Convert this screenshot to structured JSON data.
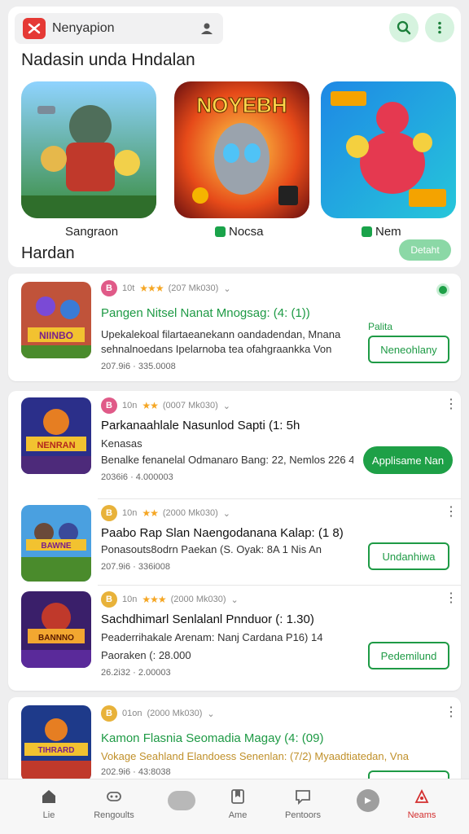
{
  "header": {
    "search_text": "Nenyapion",
    "icons": [
      "app-logo-icon",
      "profile-icon",
      "search-icon",
      "more-vertical-icon"
    ]
  },
  "featured": {
    "title": "Nadasin unda Hndalan",
    "items": [
      {
        "label": "Sangraon",
        "lock": false,
        "art_text": ""
      },
      {
        "label": "Nocsa",
        "lock": true,
        "art_text": "NOYEBH"
      },
      {
        "label": "Nem",
        "lock": true,
        "art_text": ""
      }
    ]
  },
  "section": {
    "title": "Hardan",
    "pill_label": "Detaht"
  },
  "list_items": [
    {
      "badge": "B",
      "badge_color": "#e05a88",
      "meta_prefix": "10t",
      "stars": "★★★",
      "meta_info": "(207 Mk030)",
      "title": "Pangen Nitsel Nanat Mnogsag: (4: (1))",
      "title_green": true,
      "desc1": "Upekalekoal filartaeanekann oandadendan, Mnana",
      "desc2": "sehnalnoedans Ipelarnoba tea ofahgraankka Von",
      "sub": "207.9i6 · 335.0008",
      "side_text": "Palita",
      "button_label": "Neneohlany",
      "button_style": "outline",
      "corner": "dot",
      "art_text": "NIINBO"
    },
    {
      "badge": "B",
      "badge_color": "#e05a88",
      "meta_prefix": "10n",
      "stars": "★★",
      "meta_info": "(0007 Mk030)",
      "title": "Parkanaahlale Nasunlod Sapti (1: 5h",
      "title_green": false,
      "desc1": "Kenasas",
      "desc2": "Benalke fenanelal Odmanaro Bang: 22, Nemlos 226 4h",
      "sub": "2036i6 · 4.000003",
      "side_text": "",
      "button_label": "Applisame Nan",
      "button_style": "filled",
      "corner": "kebab",
      "art_text": "NENRAN"
    },
    {
      "badge": "B",
      "badge_color": "#e8b23a",
      "meta_prefix": "10n",
      "stars": "★★",
      "meta_info": "(2000 Mk030)",
      "title": "Paabo Rap Slan Naengodanana Kalap: (1 8)",
      "title_green": false,
      "desc1": "Ponasouts8odrn Paekan (S. Oyak: 8A 1 Nis An",
      "desc2": "",
      "sub": "207.9i6 · 336i008",
      "side_text": "",
      "button_label": "Undanhiwa",
      "button_style": "outline",
      "corner": "kebab",
      "art_text": "BAWNE"
    },
    {
      "badge": "B",
      "badge_color": "#e8b23a",
      "meta_prefix": "10n",
      "stars": "★★★",
      "meta_info": "(2000 Mk030)",
      "title": "Sachdhimarl Senlalanl Pnnduor (: 1.30)",
      "title_green": false,
      "desc1": "Peaderrihakale Arenam: Nanj Cardana P16) 14",
      "desc2": "Paoraken (: 28.000",
      "sub": "26.2i32 · 2.00003",
      "side_text": "",
      "button_label": "Pedemilund",
      "button_style": "outline",
      "corner": "kebab",
      "art_text": "BANNNO"
    },
    {
      "badge": "B",
      "badge_color": "#e8b23a",
      "meta_prefix": "01on",
      "stars": "",
      "meta_info": "(2000 Mk030)",
      "title": "Kamon Flasnia Seomadia Magay (4: (09)",
      "title_green": true,
      "desc1": "Vokage Seahland Elandoess Senenlan: (7/2) Myaadtiatedan, Vna",
      "desc2": "",
      "sub": "202.9i6 · 43:8038",
      "side_text": "",
      "button_label": "",
      "button_style": "outline",
      "corner": "kebab",
      "art_text": "TIHRARD"
    }
  ],
  "bottom_nav": [
    {
      "label": "Lie",
      "icon": "home-icon",
      "active": false
    },
    {
      "label": "Rengoults",
      "icon": "games-icon",
      "active": false
    },
    {
      "label": "",
      "icon": "blob-icon",
      "active": false
    },
    {
      "label": "Ame",
      "icon": "book-icon",
      "active": false
    },
    {
      "label": "Pentoors",
      "icon": "chat-icon",
      "active": false
    },
    {
      "label": "",
      "icon": "circle-icon",
      "active": false
    },
    {
      "label": "Neams",
      "icon": "apps-icon",
      "active": true
    }
  ],
  "colors": {
    "accent_green": "#1ea047",
    "brand_red": "#e53935",
    "star": "#f5a623",
    "active_nav": "#d32f2f"
  }
}
